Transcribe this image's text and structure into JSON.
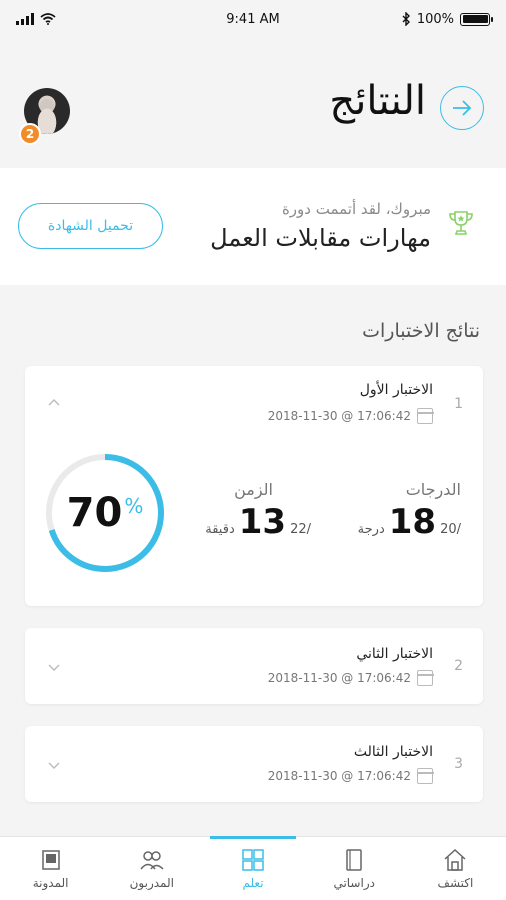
{
  "status_bar": {
    "time": "9:41 AM",
    "battery": "100%"
  },
  "header": {
    "title": "النتائج",
    "badge_count": "2"
  },
  "congrats": {
    "subtitle": "مبروك، لقد أتممت دورة",
    "course": "مهارات مقابلات العمل",
    "download_label": "تحميل الشهادة"
  },
  "results_section_title": "نتائج الاختبارات",
  "tests": [
    {
      "num": "1",
      "name": "الاختبار الأول",
      "date": "2018-11-30 @ 17:06:42",
      "percent": "70",
      "percent_unit": "%",
      "percent_value": 0.7,
      "grades_label": "الدرجات",
      "grades_value": "18",
      "grades_max": "20/",
      "grades_unit": "درجة",
      "time_label": "الزمن",
      "time_value": "13",
      "time_max": "22/",
      "time_unit": "دقيقة"
    },
    {
      "num": "2",
      "name": "الاختبار الثاني",
      "date": "2018-11-30 @ 17:06:42"
    },
    {
      "num": "3",
      "name": "الاختبار الثالث",
      "date": "2018-11-30 @ 17:06:42"
    }
  ],
  "tabs": [
    {
      "label": "المدونة",
      "icon": "blog-icon"
    },
    {
      "label": "المدربون",
      "icon": "trainers-icon"
    },
    {
      "label": "تعلم",
      "icon": "learn-icon",
      "active": true
    },
    {
      "label": "دراساتي",
      "icon": "studies-icon"
    },
    {
      "label": "اكتشف",
      "icon": "home-icon"
    }
  ],
  "colors": {
    "accent": "#3bbde7",
    "badge": "#f28c28",
    "trophy": "#8bd168"
  }
}
